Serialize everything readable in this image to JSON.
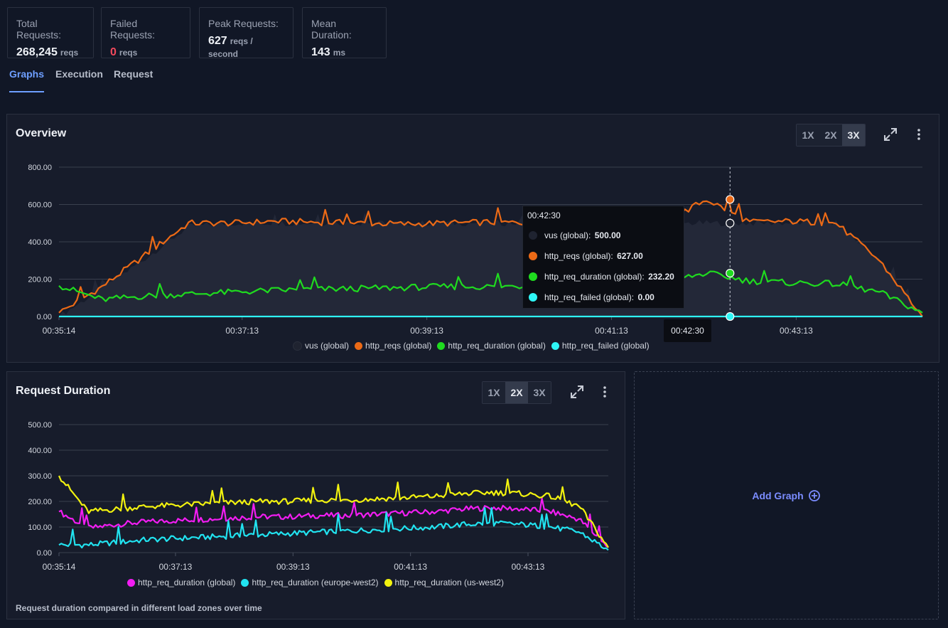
{
  "stats": [
    {
      "label": "Total Requests:",
      "value": "268,245",
      "unit": "reqs"
    },
    {
      "label": "Failed Requests:",
      "value": "0",
      "unit": "reqs",
      "status": "danger"
    },
    {
      "label": "Peak Requests:",
      "value": "627",
      "unit": "reqs / second"
    },
    {
      "label": "Mean Duration:",
      "value": "143",
      "unit": "ms"
    }
  ],
  "tabs": [
    {
      "label": "Graphs",
      "active": true
    },
    {
      "label": "Execution",
      "active": false
    },
    {
      "label": "Request",
      "active": false
    }
  ],
  "zoom_options": [
    "1X",
    "2X",
    "3X"
  ],
  "icons": {
    "expand": "expand-icon",
    "menu": "more-vertical-icon",
    "add": "plus-circle-icon"
  },
  "colors": {
    "vus": "#1f2330",
    "http_reqs": "#ec6a16",
    "http_req_duration": "#1fdb1f",
    "http_req_failed": "#2ef6f6",
    "rd_global": "#f21df2",
    "rd_europe": "#21e3f0",
    "rd_us": "#f2f20f",
    "accent": "#6e9fff"
  },
  "overview": {
    "title": "Overview",
    "zoom_active": "3X",
    "tooltip": {
      "time": "00:42:30",
      "rows": [
        {
          "label": "vus (global):",
          "value": "500.00",
          "color": "#1f2330"
        },
        {
          "label": "http_reqs (global):",
          "value": "627.00",
          "color": "#ec6a16"
        },
        {
          "label": "http_req_duration (global):",
          "value": "232.20",
          "color": "#1fdb1f"
        },
        {
          "label": "http_req_failed (global):",
          "value": "0.00",
          "color": "#2ef6f6"
        }
      ]
    },
    "cursor_time": "00:42:30"
  },
  "request_duration": {
    "title": "Request Duration",
    "zoom_active": "2X",
    "caption": "Request duration compared in different load zones over time"
  },
  "add_graph": {
    "label": "Add Graph"
  },
  "chart_data": [
    {
      "type": "line",
      "title": "Overview",
      "x": [
        "00:35:14",
        "00:35:44",
        "00:36:14",
        "00:36:44",
        "00:37:13",
        "00:37:44",
        "00:38:14",
        "00:38:44",
        "00:39:13",
        "00:39:44",
        "00:40:14",
        "00:40:44",
        "00:41:13",
        "00:41:44",
        "00:42:14",
        "00:42:30",
        "00:42:44",
        "00:43:13",
        "00:43:44",
        "00:44:14",
        "00:44:35"
      ],
      "x_ticks": [
        "00:35:14",
        "00:37:13",
        "00:39:13",
        "00:41:13",
        "00:43:13"
      ],
      "ylim": [
        0,
        800
      ],
      "y_ticks": [
        "0.00",
        "200.00",
        "400.00",
        "600.00",
        "800.00"
      ],
      "series": [
        {
          "name": "vus (global)",
          "color": "#1f2330",
          "values": [
            0,
            150,
            310,
            480,
            500,
            500,
            500,
            500,
            500,
            500,
            500,
            500,
            500,
            500,
            500,
            500,
            500,
            500,
            500,
            300,
            0
          ]
        },
        {
          "name": "http_reqs (global)",
          "color": "#ec6a16",
          "values": [
            20,
            160,
            330,
            500,
            500,
            510,
            505,
            500,
            495,
            500,
            505,
            500,
            500,
            505,
            500,
            627,
            505,
            510,
            500,
            300,
            0
          ]
        },
        {
          "name": "http_req_duration (global)",
          "color": "#1fdb1f",
          "values": [
            165,
            90,
            110,
            120,
            130,
            140,
            145,
            150,
            155,
            160,
            160,
            165,
            170,
            175,
            185,
            232,
            190,
            180,
            175,
            130,
            20
          ]
        },
        {
          "name": "http_req_failed (global)",
          "color": "#2ef6f6",
          "values": [
            0,
            0,
            0,
            0,
            0,
            0,
            0,
            0,
            0,
            0,
            0,
            0,
            0,
            0,
            0,
            0,
            0,
            0,
            0,
            0,
            0
          ]
        }
      ],
      "grid": true,
      "legend": "bottom"
    },
    {
      "type": "line",
      "title": "Request Duration",
      "x": [
        "00:35:14",
        "00:35:44",
        "00:36:14",
        "00:36:44",
        "00:37:13",
        "00:37:44",
        "00:38:14",
        "00:38:44",
        "00:39:13",
        "00:39:44",
        "00:40:14",
        "00:40:44",
        "00:41:13",
        "00:41:44",
        "00:42:14",
        "00:42:44",
        "00:43:13",
        "00:43:44",
        "00:44:14",
        "00:44:35"
      ],
      "x_ticks": [
        "00:35:14",
        "00:37:13",
        "00:39:13",
        "00:41:13",
        "00:43:13"
      ],
      "ylim": [
        0,
        500
      ],
      "y_ticks": [
        "0.00",
        "100.00",
        "200.00",
        "300.00",
        "400.00",
        "500.00"
      ],
      "series": [
        {
          "name": "http_req_duration (global)",
          "color": "#f21df2",
          "values": [
            160,
            95,
            110,
            120,
            125,
            130,
            135,
            140,
            140,
            145,
            145,
            150,
            155,
            160,
            170,
            175,
            170,
            160,
            130,
            20
          ]
        },
        {
          "name": "http_req_duration (europe-west2)",
          "color": "#21e3f0",
          "values": [
            30,
            30,
            40,
            50,
            55,
            60,
            65,
            70,
            75,
            80,
            85,
            90,
            95,
            100,
            110,
            115,
            110,
            100,
            80,
            10
          ]
        },
        {
          "name": "http_req_duration (us-west2)",
          "color": "#f2f20f",
          "values": [
            300,
            160,
            170,
            180,
            185,
            190,
            195,
            200,
            200,
            205,
            205,
            210,
            215,
            220,
            230,
            235,
            230,
            220,
            180,
            20
          ]
        }
      ],
      "grid": true,
      "legend": "bottom"
    }
  ]
}
